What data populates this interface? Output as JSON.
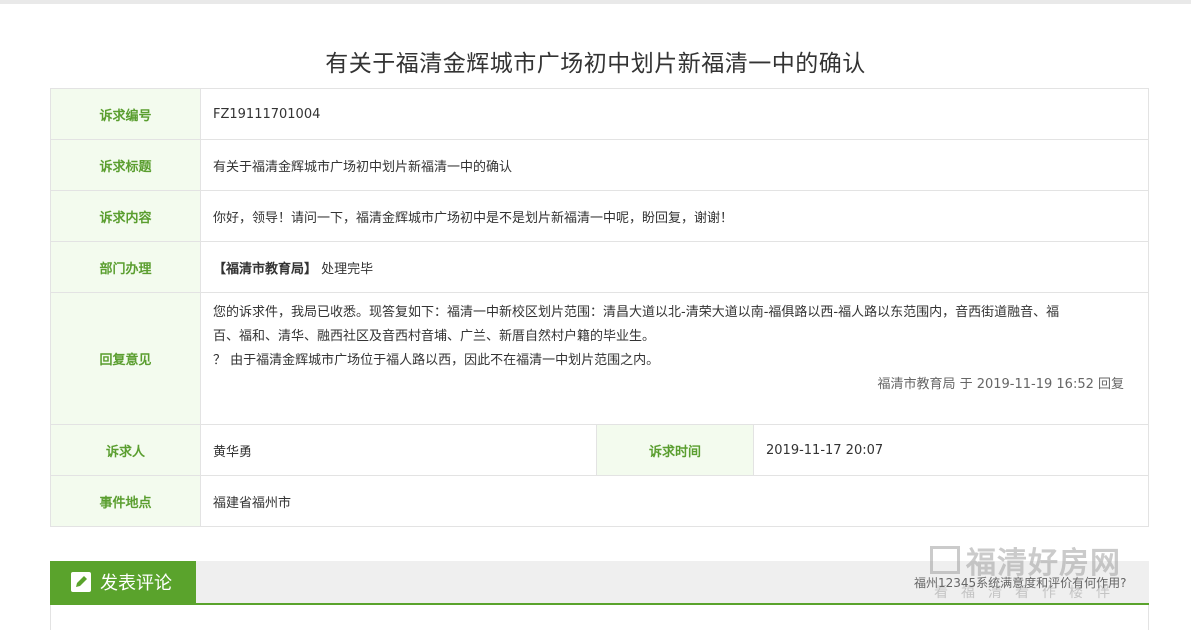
{
  "page": {
    "title": "有关于福清金辉城市广场初中划片新福清一中的确认"
  },
  "fields": {
    "number_label": "诉求编号",
    "number": "FZ19111701004",
    "subject_label": "诉求标题",
    "subject": "有关于福清金辉城市广场初中划片新福清一中的确认",
    "content_label": "诉求内容",
    "content": "你好，领导！请问一下，福清金辉城市广场初中是不是划片新福清一中呢，盼回复，谢谢！",
    "dept_label": "部门办理",
    "dept": "【福清市教育局】",
    "dept_status": "处理完毕",
    "reply_label": "回复意见",
    "reply_line1": "您的诉求件，我局已收悉。现答复如下：福清一中新校区划片范围：清昌大道以北-清荣大道以南-福俱路以西-福人路以东范围内，音西街道融音、福",
    "reply_line2": "百、福和、清华、融西社区及音西村音埔、广兰、新厝自然村户籍的毕业生。",
    "reply_line3": "？ 由于福清金辉城市广场位于福人路以西，因此不在福清一中划片范围之内。",
    "reply_meta": "福清市教育局 于 2019-11-19 16:52 回复",
    "person_label": "诉求人",
    "person": "黄华勇",
    "time_label": "诉求时间",
    "time": "2019-11-17 20:07",
    "location_label": "事件地点",
    "location": "福建省福州市"
  },
  "comment": {
    "tab_label": "发表评论",
    "tab_icon": "edit-icon"
  },
  "watermark": {
    "logo_text": "福清好房网",
    "sub_text": "看福清看作楼伴",
    "caption": "福州12345系统满意度和评价有何作用?"
  },
  "colors": {
    "accent": "#5aa32c",
    "label_bg": "#f3fbee",
    "label_text": "#5a9e2f"
  }
}
